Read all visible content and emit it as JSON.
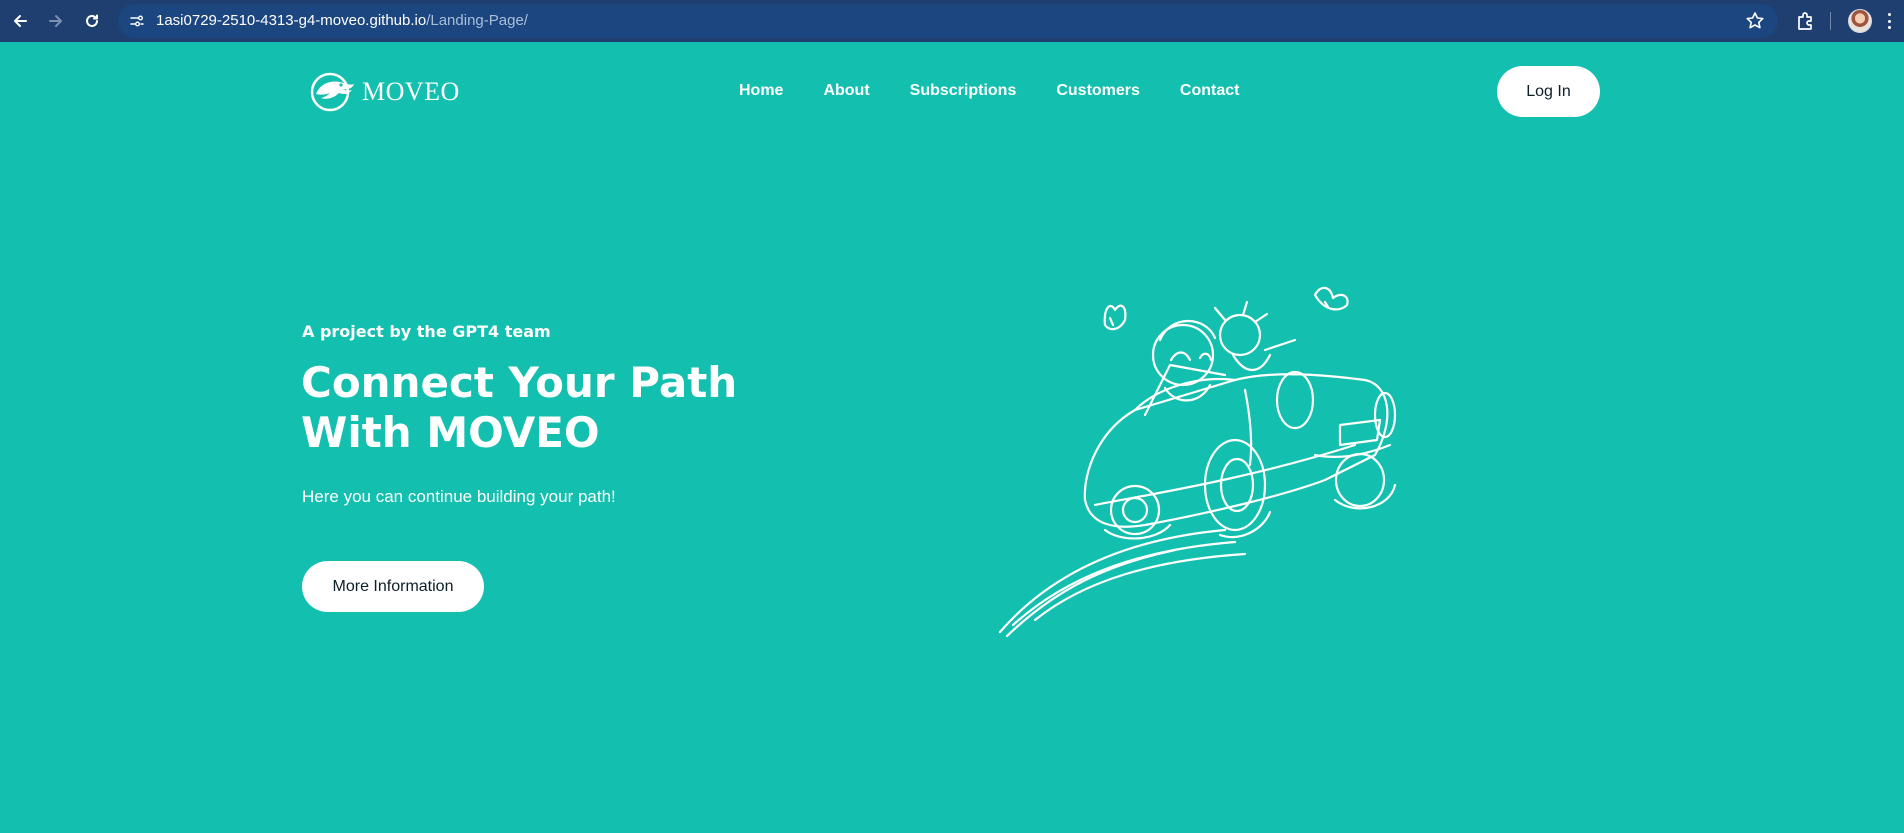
{
  "browser": {
    "url_host": "1asi0729-2510-4313-g4-moveo.github.io",
    "url_path": "/Landing-Page/",
    "icons": [
      "back-icon",
      "forward-icon",
      "reload-icon",
      "site-info-icon",
      "bookmark-star-icon",
      "extensions-icon",
      "profile-avatar",
      "menu-icon"
    ]
  },
  "header": {
    "logo_text": "MOVEO",
    "nav": [
      {
        "label": "Home"
      },
      {
        "label": "About"
      },
      {
        "label": "Subscriptions"
      },
      {
        "label": "Customers"
      },
      {
        "label": "Contact"
      }
    ],
    "login_label": "Log In"
  },
  "hero": {
    "eyebrow": "A project by the GPT4 team",
    "title": "Connect Your Path With MOVEO",
    "subtitle": "Here you can continue building your path!",
    "cta_label": "More Information",
    "illustration": "car-with-riders-illustration"
  },
  "colors": {
    "page_background": "#13bfae",
    "browser_bar": "#1e3f70",
    "button_background": "#ffffff",
    "button_text": "#0c2028"
  }
}
